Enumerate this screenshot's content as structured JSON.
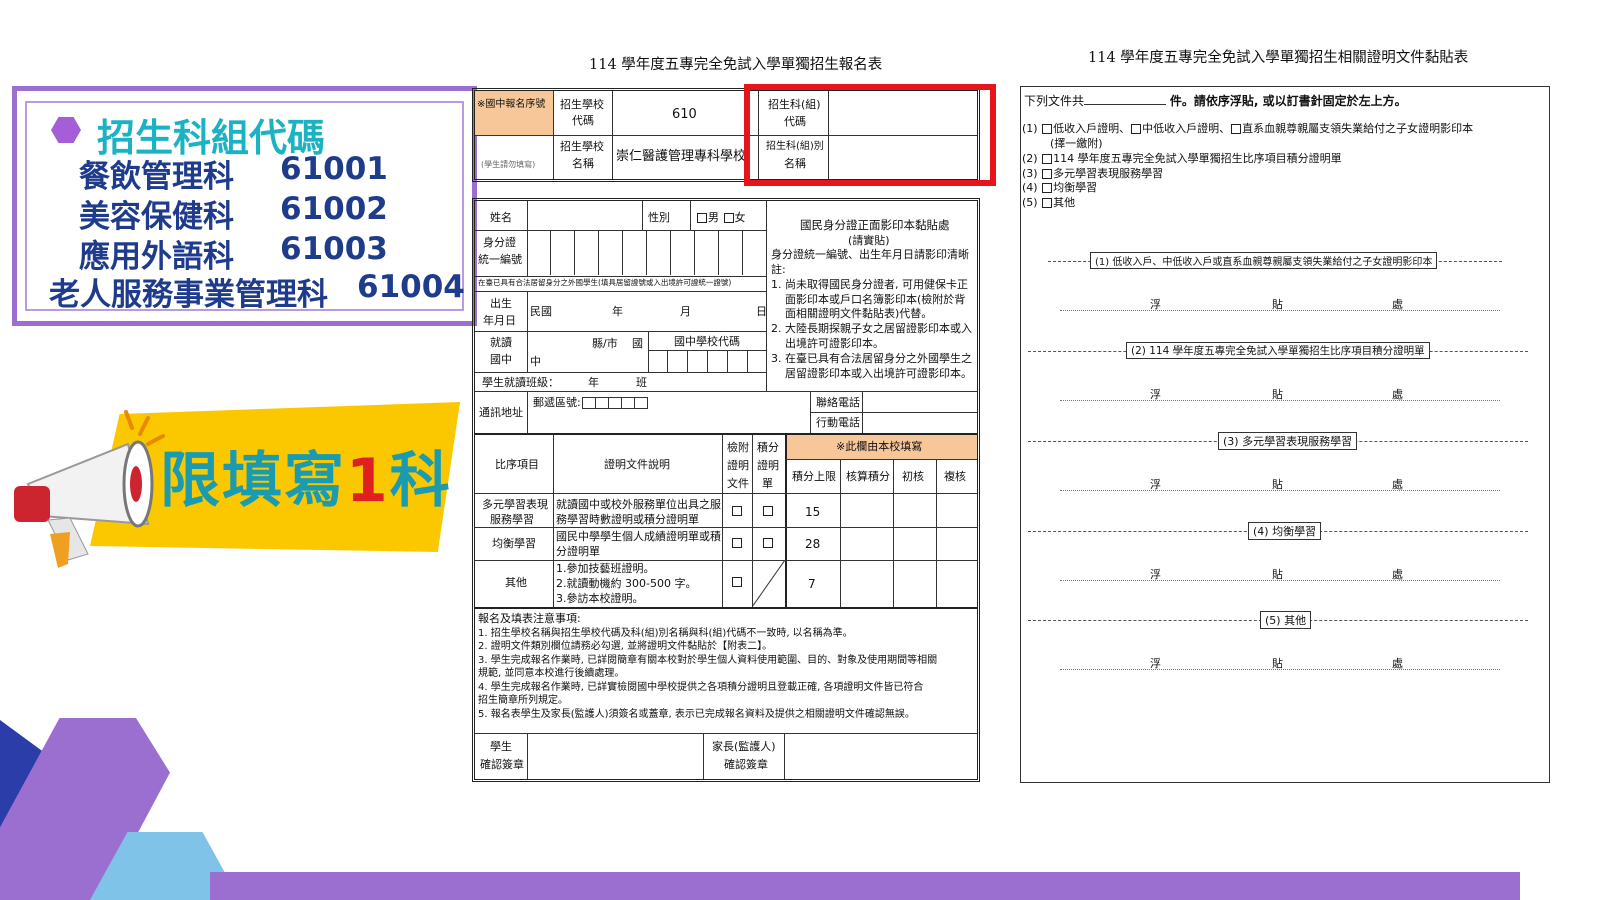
{
  "info_box": {
    "title": "招生科組代碼",
    "rows": [
      {
        "name": "餐飲管理科",
        "code": "61001"
      },
      {
        "name": "美容保健科",
        "code": "61002"
      },
      {
        "name": "應用外語科",
        "code": "61003"
      },
      {
        "name": "老人服務事業管理科",
        "code": "61004"
      }
    ]
  },
  "banner": {
    "text_before": "限填寫",
    "number": "1",
    "text_after": "科"
  },
  "form": {
    "title": "114 學年度五專完全免試入學單獨招生報名表",
    "top": {
      "serial_label": "※國中報名序號",
      "serial_note": "(學生請勿填寫)",
      "school_code_label_1": "招生學校",
      "school_code_label_2": "代碼",
      "school_code": "610",
      "school_name_label_1": "招生學校",
      "school_name_label_2": "名稱",
      "school_name": "崇仁醫護管理專科學校",
      "dept_code_label_1": "招生科(組)",
      "dept_code_label_2": "代碼",
      "dept_name_label_1": "招生科(組)別",
      "dept_name_label_2": "名稱"
    },
    "personal": {
      "name": "姓名",
      "gender": "性別",
      "male": "男",
      "female": "女",
      "id_1": "身分證",
      "id_2": "統一編號",
      "foreign_note": "在臺已具有合法居留身分之外國學生(填具居留證號或入出境許可證統一證號)",
      "birth_1": "出生",
      "birth_2": "年月日",
      "roc": "民國",
      "year": "年",
      "month": "月",
      "day": "日",
      "school_1": "就讀",
      "school_2": "國中",
      "county": "縣/市",
      "national": "國",
      "middle": "中",
      "school_code": "國中學校代碼",
      "class_label": "學生就讀班級：",
      "class_year": "年",
      "class_ban": "班",
      "address": "通訊地址",
      "postal": "郵遞區號:",
      "phone": "聯絡電話",
      "mobile": "行動電話",
      "id_photo_title": "國民身分證正面影印本黏貼處",
      "id_photo_sub": "(請實貼)",
      "id_note_lines": [
        "身分證統一編號、出生年月日請影印清晰",
        "註:",
        "1. 尚未取得國民身分證者, 可用健保卡正",
        "面影印本或戶口名簿影印本(檢附於背",
        "面相關證明文件黏貼表)代替。",
        "2. 大陸長期探親子女之居留證影印本或入",
        "出境許可證影印本。",
        "3. 在臺已具有合法居留身分之外國學生之",
        "居留證影印本或入出境許可證影印本。"
      ]
    },
    "scores": {
      "col_item": "比序項目",
      "col_desc": "證明文件說明",
      "col_attach": [
        "檢附",
        "證明",
        "文件"
      ],
      "col_score_sheet": [
        "積分",
        "證明",
        "單"
      ],
      "school_fill": "※此欄由本校填寫",
      "col_max": "積分上限",
      "col_calc": "核算積分",
      "col_first": "初核",
      "col_second": "複核",
      "rows": [
        {
          "item_1": "多元學習表現",
          "item_2": "服務學習",
          "desc_1": "就讀國中或校外服務單位出具之服",
          "desc_2": "務學習時數證明或積分證明單",
          "max": "15"
        },
        {
          "item_1": "均衡學習",
          "item_2": "",
          "desc_1": "國民中學學生個人成績證明單或積",
          "desc_2": "分證明單",
          "max": "28"
        },
        {
          "item_1": "其他",
          "item_2": "",
          "desc_1": "1.參加技藝班證明。",
          "desc_2": "2.就讀動機約 300-500 字。",
          "desc_3": "3.參訪本校證明。",
          "max": "7"
        }
      ]
    },
    "notes": {
      "title": "報名及填表注意事項:",
      "lines": [
        "1.  招生學校名稱與招生學校代碼及科(組)別名稱與科(組)代碼不一致時, 以名稱為準。",
        "2.  證明文件類別欄位請務必勾選, 並將證明文件黏貼於【附表二】。",
        "3.  學生完成報名作業時, 已詳閱簡章有關本校對於學生個人資料使用範圍、目的、對象及使用期間等相關",
        "     規範, 並同意本校進行後續處理。",
        "4.  學生完成報名作業時, 已詳實檢閱國中學校提供之各項積分證明且登載正確, 各項證明文件皆已符合",
        "     招生簡章所列規定。",
        "5.  報名表學生及家長(監護人)須簽名或蓋章, 表示已完成報名資料及提供之相關證明文件確認無誤。"
      ]
    },
    "sign": {
      "student_1": "學生",
      "student_2": "確認簽章",
      "parent_1": "家長(監護人)",
      "parent_2": "確認簽章"
    }
  },
  "attach": {
    "title": "114 學年度五專完全免試入學單獨招生相關證明文件黏貼表",
    "header_prefix": "下列文件共",
    "header_suffix": "件。請依序浮貼, 或以訂書針固定於左上方。",
    "items": [
      {
        "num": "(1)",
        "text": "低收入戶證明、",
        "text2": "中低收入戶證明、",
        "text3": "直系血親尊親屬支領失業給付之子女證明影印本",
        "sub": "(擇一繳附)"
      },
      {
        "num": "(2)",
        "text": "114 學年度五專完全免試入學單獨招生比序項目積分證明單"
      },
      {
        "num": "(3)",
        "text": "多元學習表現服務學習"
      },
      {
        "num": "(4)",
        "text": "均衡學習"
      },
      {
        "num": "(5)",
        "text": "其他"
      }
    ],
    "sections": [
      "(1) 低收入戶、中低收入戶或直系血親尊親屬支領失業給付之子女證明影印本",
      "(2) 114 學年度五專完全免試入學單獨招生比序項目積分證明單",
      "(3) 多元學習表現服務學習",
      "(4) 均衡學習",
      "(5) 其他"
    ],
    "paste": [
      "浮",
      "貼",
      "處"
    ]
  },
  "colors": {
    "accent_purple": "#9b6fd0",
    "title_teal": "#1bb3c3",
    "code_navy": "#1f3c8c",
    "banner_yellow": "#fbc800",
    "highlight_red": "#e8141c",
    "orange_cell": "#f7c79a"
  }
}
